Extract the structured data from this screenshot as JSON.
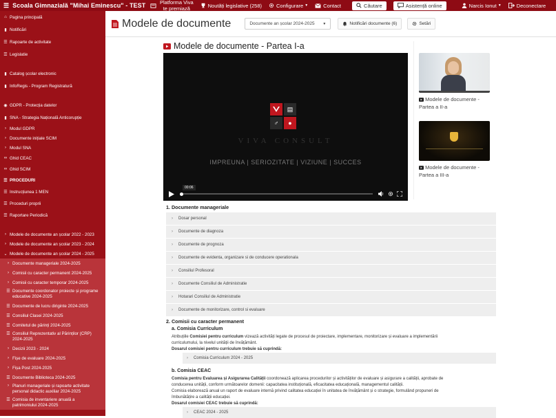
{
  "header": {
    "app_title": "Scoala Gimnazială \"Mihai Eminescu\" - TEST",
    "nav": {
      "platform_line1": "Platforma Viva",
      "platform_line2": "te premiază",
      "legislative": "Noutăți legislative (258)",
      "configure": "Configurare",
      "contact": "Contact",
      "search": "Căutare",
      "assist": "Asistență online",
      "user": "Narcis Ionut",
      "logout": "Deconectare"
    }
  },
  "sidebar": {
    "items": [
      {
        "label": "Pagina principală"
      },
      {
        "label": "Notificări"
      },
      {
        "label": "Rapoarte de activitate"
      },
      {
        "label": "Legislatie"
      },
      {
        "label": "Catalog școlar electronic"
      },
      {
        "label": "InfoRegis - Program Registratură"
      },
      {
        "label": "GDPR - Protecția datelor"
      },
      {
        "label": "SNA - Strategia Națională Anticorupție"
      },
      {
        "label": "Modul GDPR"
      },
      {
        "label": "Documente inițiale SCIM"
      },
      {
        "label": "Modul SNA"
      },
      {
        "label": "Ghid CEAC"
      },
      {
        "label": "Ghid SCIM"
      },
      {
        "label": "PROCEDURI"
      },
      {
        "label": "Instrucțiunea 1 MEN"
      },
      {
        "label": "Proceduri proprii"
      },
      {
        "label": "Raportare Periodică"
      },
      {
        "label": "Modele de documente an școlar 2022 - 2023"
      },
      {
        "label": "Modele de documente an școlar 2023 - 2024"
      },
      {
        "label": "Modele de documente an școlar 2024 - 2025"
      }
    ],
    "subitems": [
      {
        "label": "Documente manageriale 2024-2025"
      },
      {
        "label": "Comisii cu caracter permanent 2024-2025"
      },
      {
        "label": "Comisii cu caracter temporar 2024-2025"
      },
      {
        "label": "Documente coordonator proiecte și programe",
        "label2": "educative 2024-2025"
      },
      {
        "label": "Documente de lucru diriginte 2024-2025"
      },
      {
        "label": "Consiliul Clasei 2024-2025"
      },
      {
        "label": "Comitetul de părinți 2024-2025"
      },
      {
        "label": "Consiliul Reprezentativ al Părinților (CRP)",
        "label2": "2024-2025"
      },
      {
        "label": "Decizii 2023 - 2024"
      },
      {
        "label": "Fișe de evaluare 2024-2025"
      },
      {
        "label": "Fișa Post 2024-2025"
      },
      {
        "label": "Documente Biblioteca 2024-2025"
      },
      {
        "label": "Planuri manageriale și rapoarte activitate",
        "label2": "personal didactic auxiliar 2024-2025"
      },
      {
        "label": "Comisia de inventariere anuală a",
        "label2": "patrimoniului 2024-2025"
      }
    ]
  },
  "page": {
    "title": "Modele de documente",
    "select_value": "Documente an școlar 2024-2025",
    "notify_button": "Notificări documente (6)",
    "settings_button": "Setări"
  },
  "video": {
    "title": "Modele de documente - Partea I-a",
    "brand_text": "VIVA CONSULT",
    "motto": "IMPREUNA | SERIOZITATE | VIZIUNE | SUCCES",
    "time": "00:06",
    "side": [
      {
        "title": "Modele de documente -",
        "title2": "Partea a II-a"
      },
      {
        "title": "Modele de documente -",
        "title2": "Partea a III-a"
      }
    ]
  },
  "sections": {
    "s1_title": "1. Documente manageriale",
    "s1_items": [
      "Dosar personal",
      "Documente de diagnoza",
      "Documente de prognoza",
      "Documente de evidenta, organizare si de conducere operationala",
      "Consiliul Profesoral",
      "Documente Consiliul de Administratie",
      "Hotarari Consiliul de Administratie",
      "Documente de monitorizare, control si evaluare"
    ],
    "s2_title": "2. Comisii cu caracter permanent",
    "a_title": "a. Comisia Curriculum",
    "a_text1_pre": "Atribuțiile ",
    "a_text1_bold": "Comisiei pentru curriculum",
    "a_text1_post": " vizează activități legate de procesul de proiectare, implementare, monitorizare și evaluare a implementării",
    "a_text2": "curriculumului, la nivelul unității de învățământ.",
    "a_dosar": "Dosarul comisiei pentru curriculum trebuie să cuprindă:",
    "a_acc": "Comisia Curriculum 2024 - 2025",
    "b_title": "b. Comisia CEAC",
    "b_text1_bold": "Comisia pentru Evaluarea și Asigurarea Calității",
    "b_text1_post": " coordonează aplicarea procedurilor și activităților de evaluare și asigurare a calității, aprobate de",
    "b_text2": "conducerea unității, conform următoarelor domenii: capacitatea instituțională, eficacitatea educațională, managementul calității.",
    "b_text3": "Comisia elaborează anual un raport de evaluare internă privind calitatea educației în unitatea de învățământ și o strategie, formulând propuneri de",
    "b_text4": "îmbunătățire a calității educației.",
    "b_dosar": "Dosarul comisiei CEAC trebuie să cuprindă:",
    "b_acc": "CEAC 2024 - 2025"
  },
  "colors": {
    "topbar": "#8e0b14",
    "sidebar": "#9b1118",
    "sidebar_sub": "#b9343a",
    "accent": "#c0171f"
  }
}
